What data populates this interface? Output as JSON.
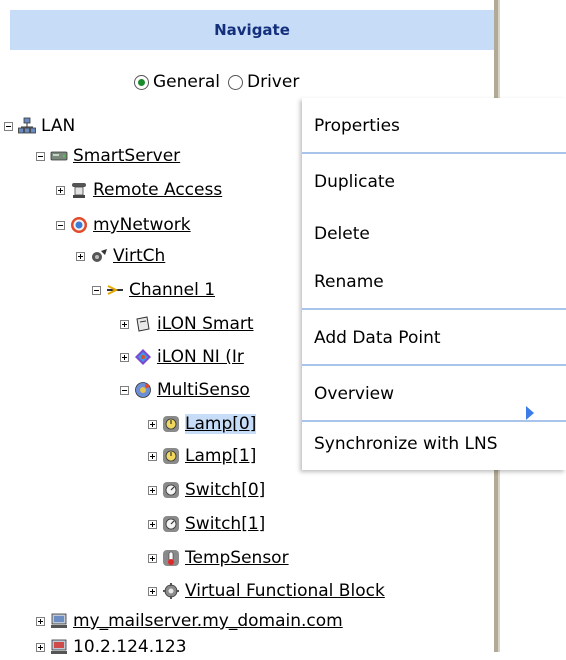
{
  "header": {
    "title": "Navigate"
  },
  "view_mode": {
    "options": [
      "General",
      "Driver"
    ],
    "selected": "General"
  },
  "tree": {
    "lan": "LAN",
    "smartserver": "SmartServer",
    "remote_access": "Remote Access",
    "mynetwork": "myNetwork",
    "virtch": "VirtCh",
    "channel1": "Channel 1",
    "ilon_smart": "iLON Smart",
    "ilon_ni": "iLON NI (Ir",
    "multisensor": "MultiSenso",
    "lamp0": "Lamp[0]",
    "lamp1": "Lamp[1]",
    "switch0": "Switch[0]",
    "switch1": "Switch[1]",
    "tempsensor": "TempSensor",
    "vfb": "Virtual Functional Block",
    "mailserver": "my_mailserver.my_domain.com",
    "ip": "10.2.124.123"
  },
  "context_menu": {
    "items": [
      "Properties",
      "Duplicate",
      "Delete",
      "Rename",
      "Add Data Point",
      "Overview",
      "Synchronize with LNS"
    ]
  },
  "colors": {
    "header_bg": "#c7dcf7",
    "header_text": "#14307d",
    "separator": "#a9c4ea",
    "submenu_arrow": "#3c7ce6"
  }
}
